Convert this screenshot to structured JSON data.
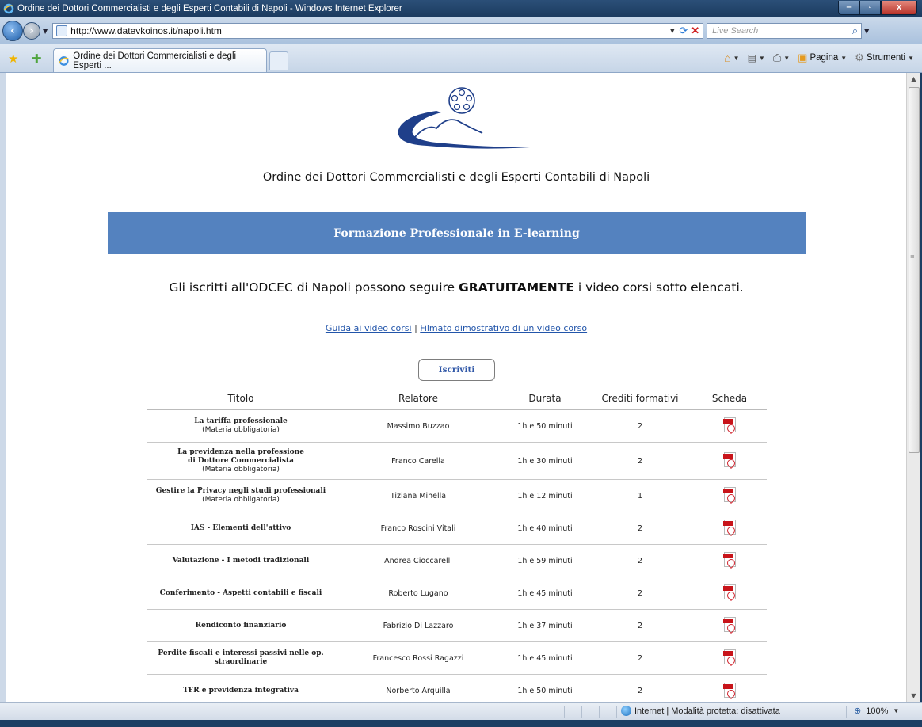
{
  "window": {
    "title": "Ordine dei Dottori Commercialisti e degli Esperti Contabili di Napoli - Windows Internet Explorer",
    "controls": {
      "minimize": "–",
      "maximize": "▫",
      "close": "x"
    }
  },
  "address_bar": {
    "url": "http://www.datevkoinos.it/napoli.htm",
    "search_placeholder": "Live Search"
  },
  "tab_bar": {
    "tab_title": "Ordine dei Dottori Commercialisti e degli Esperti ...",
    "commands": {
      "page": "Pagina",
      "tools": "Strumenti"
    }
  },
  "page": {
    "org_name": "Ordine dei Dottori Commercialisti e degli Esperti Contabili di Napoli",
    "banner": "Formazione Professionale in E-learning",
    "intro_before": "Gli iscritti all'ODCEC di Napoli possono seguire ",
    "intro_bold": "GRATUITAMENTE",
    "intro_after": " i video corsi sotto elencati.",
    "link_guide": "Guida ai video corsi",
    "link_separator": "|",
    "link_demo": "Filmato dimostrativo di un video corso",
    "subscribe_label": "Iscriviti",
    "table": {
      "headers": [
        "Titolo",
        "Relatore",
        "Durata",
        "Crediti formativi",
        "Scheda"
      ],
      "rows": [
        {
          "title": "La tariffa professionale",
          "mandatory": "(Materia obbligatoria)",
          "speaker": "Massimo Buzzao",
          "duration": "1h e 50 minuti",
          "credits": "2"
        },
        {
          "title": "La previdenza nella professione di Dottore Commercialista",
          "mandatory": "(Materia obbligatoria)",
          "speaker": "Franco Carella",
          "duration": "1h e 30 minuti",
          "credits": "2"
        },
        {
          "title": "Gestire la Privacy negli studi professionali",
          "mandatory": "(Materia obbligatoria)",
          "speaker": "Tiziana Minella",
          "duration": "1h e 12 minuti",
          "credits": "1"
        },
        {
          "title": "IAS - Elementi dell'attivo",
          "speaker": "Franco Roscini Vitali",
          "duration": "1h e 40 minuti",
          "credits": "2"
        },
        {
          "title": "Valutazione - I metodi tradizionali",
          "speaker": "Andrea Cioccarelli",
          "duration": "1h e 59 minuti",
          "credits": "2"
        },
        {
          "title": "Conferimento - Aspetti contabili e fiscali",
          "speaker": "Roberto Lugano",
          "duration": "1h e 45 minuti",
          "credits": "2"
        },
        {
          "title": "Rendiconto finanziario",
          "speaker": "Fabrizio Di Lazzaro",
          "duration": "1h e 37 minuti",
          "credits": "2"
        },
        {
          "title": "Perdite fiscali e interessi passivi nelle op. straordinarie",
          "speaker": "Francesco Rossi Ragazzi",
          "duration": "1h e 45 minuti",
          "credits": "2"
        },
        {
          "title": "TFR e previdenza integrativa",
          "speaker": "Norberto Arquilla",
          "duration": "1h e 50 minuti",
          "credits": "2"
        }
      ]
    }
  },
  "status_bar": {
    "zone": "Internet | Modalità protetta: disattivata",
    "zoom": "100%"
  },
  "colors": {
    "banner": "#5482bf",
    "link": "#2255aa",
    "logo_blue": "#1f3f8a"
  }
}
